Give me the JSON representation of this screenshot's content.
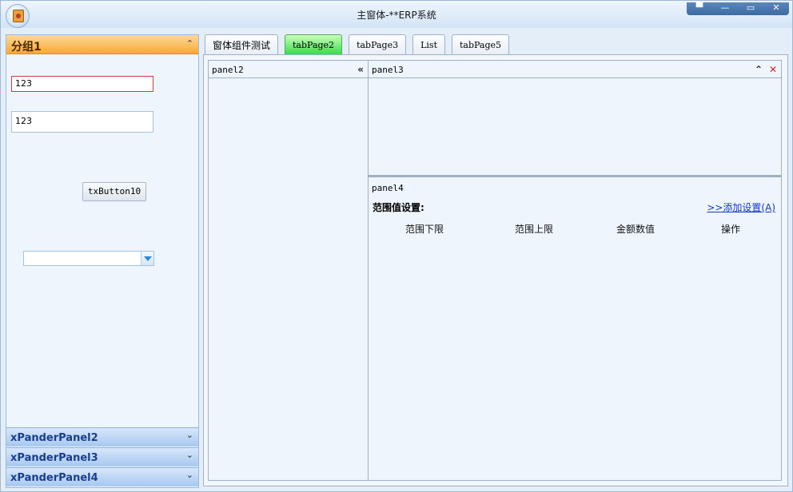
{
  "window": {
    "title": "主窗体-**ERP系统",
    "controls": [
      "▀",
      "—",
      "▭",
      "✕"
    ]
  },
  "left_panel": {
    "group1": {
      "label": "分组1",
      "chevron": "⌃"
    },
    "input1_value": "123",
    "input2_value": "123",
    "button_label": "txButton10",
    "combo_value": "",
    "collapsed_groups": [
      {
        "label": "xPanderPanel2",
        "chevron": "⌄"
      },
      {
        "label": "xPanderPanel3",
        "chevron": "⌄"
      },
      {
        "label": "xPanderPanel4",
        "chevron": "⌄"
      }
    ]
  },
  "tabs": [
    {
      "label": "窗体组件测试",
      "active": false
    },
    {
      "label": "tabPage2",
      "active": true
    },
    {
      "label": "tabPage3",
      "active": false
    },
    {
      "label": "List",
      "active": false
    },
    {
      "label": "tabPage5",
      "active": false
    }
  ],
  "panel2": {
    "label": "panel2",
    "collapse_icon": "«"
  },
  "panel3": {
    "label": "panel3",
    "collapse_icon": "⌃",
    "close_icon": "✕"
  },
  "panel4": {
    "label": "panel4",
    "range_title": "范围值设置:",
    "add_link": ">>添加设置(A)",
    "columns": [
      "范围下限",
      "范围上限",
      "金额数值",
      "操作"
    ]
  }
}
